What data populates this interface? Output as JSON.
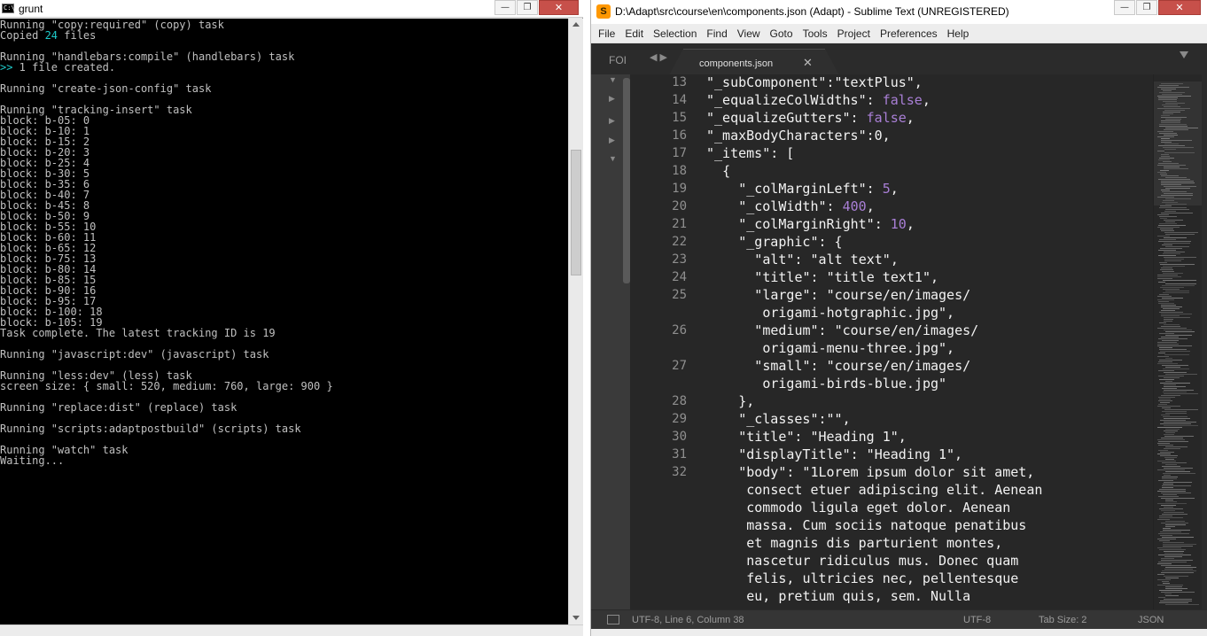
{
  "cmd": {
    "title": "grunt",
    "icon": "command-prompt-icon",
    "icon_text": "C:\\",
    "window_buttons": {
      "minimize": "—",
      "maximize": "❐",
      "close": "✕"
    },
    "lines": [
      [
        "Running \"copy:required\" (copy) task"
      ],
      [
        "Copied ",
        {
          "hl": "24"
        },
        " files"
      ],
      [
        ""
      ],
      [
        "Running \"handlebars:compile\" (handlebars) task"
      ],
      [
        {
          "hl": ">>"
        },
        " 1 file created."
      ],
      [
        ""
      ],
      [
        "Running \"create-json-config\" task"
      ],
      [
        ""
      ],
      [
        "Running \"tracking-insert\" task"
      ],
      [
        "block: b-05: 0"
      ],
      [
        "block: b-10: 1"
      ],
      [
        "block: b-15: 2"
      ],
      [
        "block: b-20: 3"
      ],
      [
        "block: b-25: 4"
      ],
      [
        "block: b-30: 5"
      ],
      [
        "block: b-35: 6"
      ],
      [
        "block: b-40: 7"
      ],
      [
        "block: b-45: 8"
      ],
      [
        "block: b-50: 9"
      ],
      [
        "block: b-55: 10"
      ],
      [
        "block: b-60: 11"
      ],
      [
        "block: b-65: 12"
      ],
      [
        "block: b-75: 13"
      ],
      [
        "block: b-80: 14"
      ],
      [
        "block: b-85: 15"
      ],
      [
        "block: b-90: 16"
      ],
      [
        "block: b-95: 17"
      ],
      [
        "block: b-100: 18"
      ],
      [
        "block: b-105: 19"
      ],
      [
        "Task complete. The latest tracking ID is 19"
      ],
      [
        ""
      ],
      [
        "Running \"javascript:dev\" (javascript) task"
      ],
      [
        ""
      ],
      [
        "Running \"less:dev\" (less) task"
      ],
      [
        "screen size: { small: 520, medium: 760, large: 900 }"
      ],
      [
        ""
      ],
      [
        "Running \"replace:dist\" (replace) task"
      ],
      [
        ""
      ],
      [
        "Running \"scripts:adaptpostbuild\" (scripts) task"
      ],
      [
        ""
      ],
      [
        "Running \"watch\" task"
      ],
      [
        "Waiting..."
      ]
    ]
  },
  "sublime": {
    "title": "D:\\Adapt\\src\\course\\en\\components.json (Adapt) - Sublime Text (UNREGISTERED)",
    "app_icon": "sublime-text-icon",
    "app_icon_text": "S",
    "window_buttons": {
      "minimize": "—",
      "maximize": "❐",
      "close": "✕"
    },
    "menu": [
      "File",
      "Edit",
      "Selection",
      "Find",
      "View",
      "Goto",
      "Tools",
      "Project",
      "Preferences",
      "Help"
    ],
    "sidebar_label": "FOI",
    "nav_arrows": "◀ ▶",
    "tab": {
      "label": "components.json",
      "close": "✕"
    },
    "code_lines": [
      {
        "n": "13",
        "indent": 4,
        "parts": [
          [
            "s",
            "\"_subComponent\":\"textPlus\","
          ]
        ]
      },
      {
        "n": "14",
        "indent": 4,
        "parts": [
          [
            "s",
            "\"_equalizeColWidths\": "
          ],
          [
            "k",
            "false"
          ],
          [
            "s",
            ","
          ]
        ]
      },
      {
        "n": "15",
        "indent": 4,
        "parts": [
          [
            "s",
            "\"_equalizeGutters\": "
          ],
          [
            "k",
            "false"
          ],
          [
            "s",
            ","
          ]
        ]
      },
      {
        "n": "16",
        "indent": 4,
        "parts": [
          [
            "s",
            "\"_maxBodyCharacters\":0,"
          ]
        ]
      },
      {
        "n": "17",
        "indent": 4,
        "parts": [
          [
            "s",
            "\"_items\": ["
          ]
        ]
      },
      {
        "n": "18",
        "indent": 6,
        "parts": [
          [
            "s",
            "{"
          ]
        ]
      },
      {
        "n": "19",
        "indent": 8,
        "parts": [
          [
            "s",
            "\"_colMarginLeft\": "
          ],
          [
            "k",
            "5"
          ],
          [
            "s",
            ","
          ]
        ]
      },
      {
        "n": "20",
        "indent": 8,
        "parts": [
          [
            "s",
            "\"_colWidth\": "
          ],
          [
            "k",
            "400"
          ],
          [
            "s",
            ","
          ]
        ]
      },
      {
        "n": "21",
        "indent": 8,
        "parts": [
          [
            "s",
            "\"_colMarginRight\": "
          ],
          [
            "k",
            "10"
          ],
          [
            "s",
            ","
          ]
        ]
      },
      {
        "n": "22",
        "indent": 8,
        "parts": [
          [
            "s",
            "\"_graphic\": {"
          ]
        ]
      },
      {
        "n": "23",
        "indent": 10,
        "parts": [
          [
            "s",
            "\"alt\": \"alt text\","
          ]
        ]
      },
      {
        "n": "24",
        "indent": 10,
        "parts": [
          [
            "s",
            "\"title\": \"title text1\","
          ]
        ]
      },
      {
        "n": "25",
        "indent": 10,
        "parts": [
          [
            "s",
            "\"large\": \"course/en/images/"
          ]
        ]
      },
      {
        "n": "",
        "indent": 11,
        "parts": [
          [
            "s",
            "origami-hotgraphic.jpg\","
          ]
        ]
      },
      {
        "n": "26",
        "indent": 10,
        "parts": [
          [
            "s",
            "\"medium\": \"course/en/images/"
          ]
        ]
      },
      {
        "n": "",
        "indent": 11,
        "parts": [
          [
            "s",
            "origami-menu-three.jpg\","
          ]
        ]
      },
      {
        "n": "27",
        "indent": 10,
        "parts": [
          [
            "s",
            "\"small\": \"course/en/images/"
          ]
        ]
      },
      {
        "n": "",
        "indent": 11,
        "parts": [
          [
            "s",
            "origami-birds-blue.jpg\""
          ]
        ]
      },
      {
        "n": "28",
        "indent": 8,
        "parts": [
          [
            "s",
            "},"
          ]
        ]
      },
      {
        "n": "29",
        "indent": 8,
        "parts": [
          [
            "s",
            "\"_classes\":\"\","
          ]
        ]
      },
      {
        "n": "30",
        "indent": 8,
        "parts": [
          [
            "s",
            "\"title\": \"Heading 1\","
          ]
        ]
      },
      {
        "n": "31",
        "indent": 8,
        "parts": [
          [
            "s",
            "\"displayTitle\": \"Heading 1\","
          ]
        ]
      },
      {
        "n": "32",
        "indent": 8,
        "parts": [
          [
            "s",
            "\"body\": \"1Lorem ipsum dolor sit amet,"
          ]
        ]
      },
      {
        "n": "",
        "indent": 9,
        "parts": [
          [
            "s",
            "consect etuer adipiscing elit. Aenean"
          ]
        ]
      },
      {
        "n": "",
        "indent": 9,
        "parts": [
          [
            "s",
            "commodo ligula eget dolor. Aenean"
          ]
        ]
      },
      {
        "n": "",
        "indent": 9,
        "parts": [
          [
            "s",
            "massa. Cum sociis natoque penatibus"
          ]
        ]
      },
      {
        "n": "",
        "indent": 9,
        "parts": [
          [
            "s",
            "et magnis dis parturient montes,"
          ]
        ]
      },
      {
        "n": "",
        "indent": 9,
        "parts": [
          [
            "s",
            "nascetur ridiculus mus. Donec quam"
          ]
        ]
      },
      {
        "n": "",
        "indent": 9,
        "parts": [
          [
            "s",
            "felis, ultricies nec, pellentesque"
          ]
        ]
      },
      {
        "n": "",
        "indent": 9,
        "parts": [
          [
            "s",
            "eu, pretium quis, sem. Nulla"
          ]
        ]
      }
    ],
    "status": {
      "position": "UTF-8, Line 6, Column 38",
      "encoding": "UTF-8",
      "tab_size": "Tab Size: 2",
      "syntax": "JSON"
    },
    "colors": {
      "keyword": "#a97fd6",
      "text": "#f2f2f2",
      "editor_bg": "#272727"
    }
  }
}
